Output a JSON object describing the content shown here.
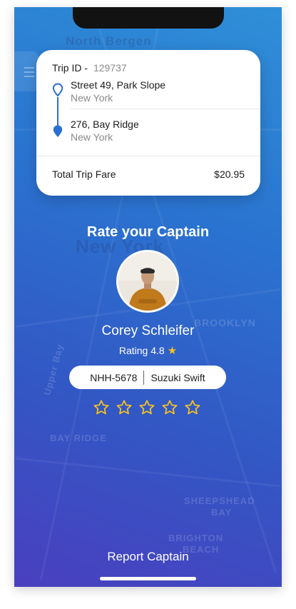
{
  "trip": {
    "id_label": "Trip ID -",
    "id_value": "129737",
    "pickup": {
      "address": "Street 49, Park Slope",
      "city": "New York"
    },
    "dropoff": {
      "address": "276, Bay Ridge",
      "city": "New York"
    },
    "fare_label": "Total Trip Fare",
    "fare_value": "$20.95"
  },
  "rate": {
    "title": "Rate your Captain",
    "captain_name": "Corey Schleifer",
    "rating_text": "Rating 4.8",
    "rating_icon": "star-icon",
    "vehicle_plate": "NHH-5678",
    "vehicle_model": "Suzuki Swift",
    "stars_total": 5,
    "stars_selected": 0
  },
  "map_labels": {
    "north_bergen": "North Bergen",
    "new_york": "New York",
    "brooklyn": "BROOKLYN",
    "upper_bay": "Upper Bay",
    "bay_ridge": "BAY RIDGE",
    "sheepshead": "SHEEPSHEAD",
    "bay": "BAY",
    "brighton": "BRIGHTON",
    "beach": "BEACH"
  },
  "footer": {
    "report_label": "Report Captain"
  },
  "colors": {
    "accent": "#2d6fd0",
    "star": "#f6c022",
    "gradient_top": "#2f8fd8",
    "gradient_bottom": "#4a3fbf"
  }
}
